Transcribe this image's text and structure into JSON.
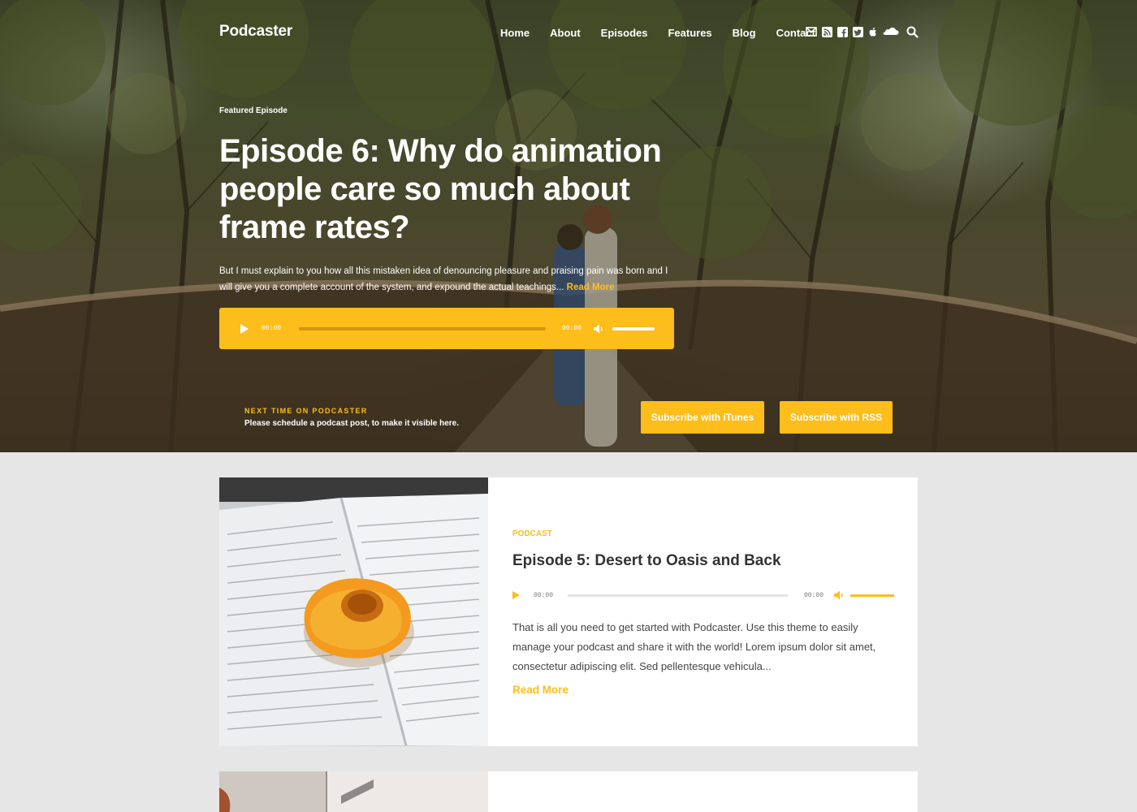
{
  "site": {
    "logo": "Podcaster"
  },
  "nav": {
    "items": [
      "Home",
      "About",
      "Episodes",
      "Features",
      "Blog",
      "Contact"
    ]
  },
  "social_icons": [
    "mail-icon",
    "rss-icon",
    "facebook-icon",
    "twitter-icon",
    "apple-icon",
    "soundcloud-icon"
  ],
  "featured": {
    "eyebrow": "Featured Episode",
    "title": "Episode 6: Why do animation people care so much about frame rates?",
    "excerpt": "But I must explain to you how all this mistaken idea of denouncing pleasure and praising pain was born and I will give you a complete account of the system, and expound the actual teachings... ",
    "read_more": "Read More",
    "player": {
      "current": "00:00",
      "duration": "00:00"
    }
  },
  "next_time": {
    "label": "NEXT TIME ON PODCASTER",
    "text": "Please schedule a podcast post, to make it visible here."
  },
  "subscribe": {
    "itunes": "Subscribe with iTunes",
    "rss": "Subscribe with RSS"
  },
  "episodes": [
    {
      "category": "PODCAST",
      "title": "Episode 5: Desert to Oasis and Back",
      "player": {
        "current": "00:00",
        "duration": "00:00"
      },
      "excerpt": "That is all you need to get started with Podcaster. Use this theme to easily manage your podcast and share it with the world! Lorem ipsum dolor sit amet, consectetur adipiscing elit. Sed pellentesque vehicula...",
      "read_more": "Read More"
    }
  ],
  "colors": {
    "accent": "#fdbd1b",
    "page_bg": "#e6e6e6",
    "card_bg": "#ffffff"
  }
}
